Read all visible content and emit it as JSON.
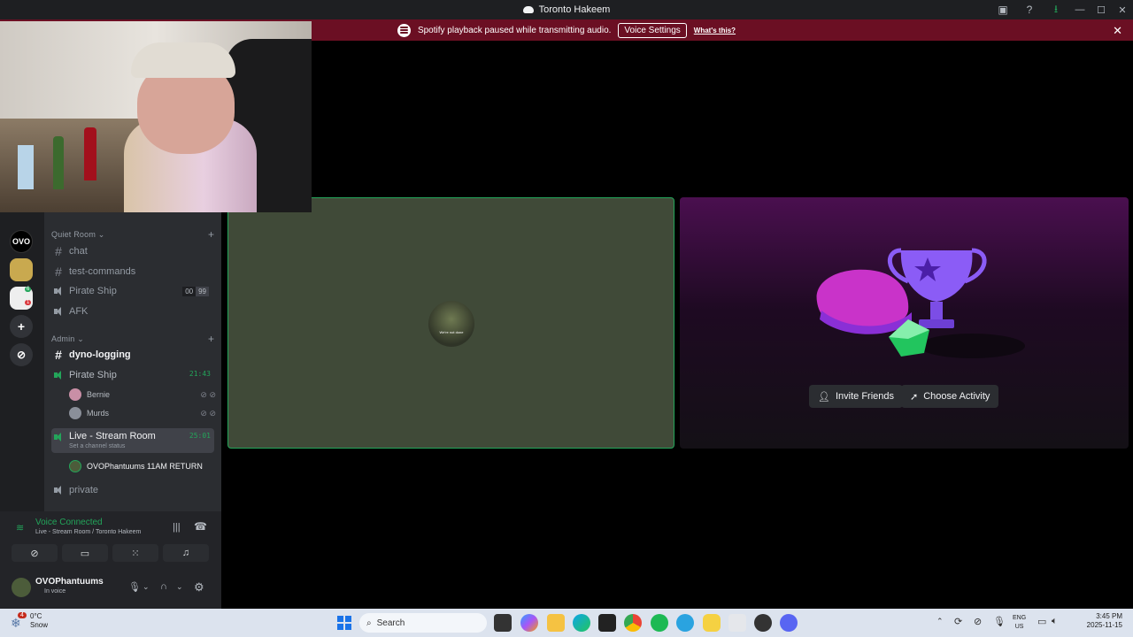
{
  "window": {
    "title": "Toronto Hakeem",
    "min": "—",
    "max": "☐",
    "close": "✕"
  },
  "banner": {
    "message": "Spotify playback paused while transmitting audio.",
    "button": "Voice Settings",
    "link": "What's this?"
  },
  "servers": [
    {
      "label": "OVO",
      "color": "#000000"
    },
    {
      "label": "",
      "color": "#c9a94f"
    },
    {
      "label": "",
      "color": "#ffffff"
    },
    {
      "label": "+",
      "color": "#313338"
    },
    {
      "label": "⊘",
      "color": "#313338"
    }
  ],
  "server_badges": {
    "b1": "6",
    "b2": "1"
  },
  "channels": {
    "cat_quiet": "Quiet Room",
    "chat": "chat",
    "test": "test-commands",
    "pirate1": "Pirate Ship",
    "pirate1_pill_a": "00",
    "pirate1_pill_b": "99",
    "afk": "AFK",
    "cat_admin": "Admin",
    "dyno": "dyno-logging",
    "pirate2": "Pirate Ship",
    "pirate2_timer": "21:43",
    "member1": "Bernie",
    "member2": "Murds",
    "live": "Live - Stream Room",
    "live_timer": "25:01",
    "live_status": "Set a channel status",
    "member3": "OVOPhantuums 11AM RETURN",
    "private": "private"
  },
  "voice": {
    "status": "Voice Connected",
    "location": "Live - Stream Room / Toronto Hakeem"
  },
  "user": {
    "name": "OVOPhantuums",
    "status": "In voice"
  },
  "stage": {
    "avatar_caption": "We're not done",
    "invite": "Invite Friends",
    "activity": "Choose Activity"
  },
  "taskbar": {
    "temp": "0°C",
    "weather": "Snow",
    "search": "Search",
    "lang1": "ENG",
    "lang2": "US",
    "time": "3:45 PM",
    "date": "2025-11-15",
    "weather_badge": "4"
  },
  "colors": {
    "accent_green": "#23a55a",
    "banner": "#6b0f23",
    "spotify_green": "#1db954"
  }
}
